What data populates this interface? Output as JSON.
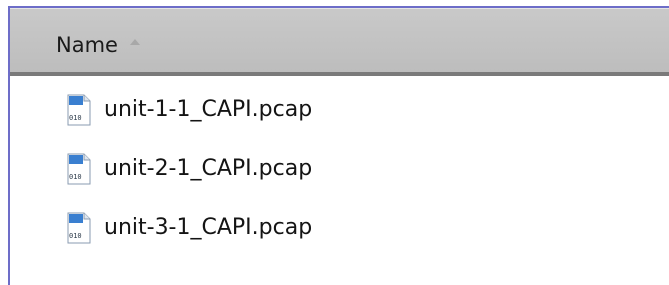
{
  "header": {
    "name_label": "Name",
    "sort_indicator": "sort-ascending-icon"
  },
  "files": [
    {
      "name": "unit-1-1_CAPI.pcap",
      "icon": "pcap-file-icon"
    },
    {
      "name": "unit-2-1_CAPI.pcap",
      "icon": "pcap-file-icon"
    },
    {
      "name": "unit-3-1_CAPI.pcap",
      "icon": "pcap-file-icon"
    }
  ],
  "colors": {
    "header_bg": "#c4c4c4",
    "header_border": "#7a7a7a",
    "window_border": "#6d6dc8",
    "icon_accent": "#3a7fd0"
  }
}
